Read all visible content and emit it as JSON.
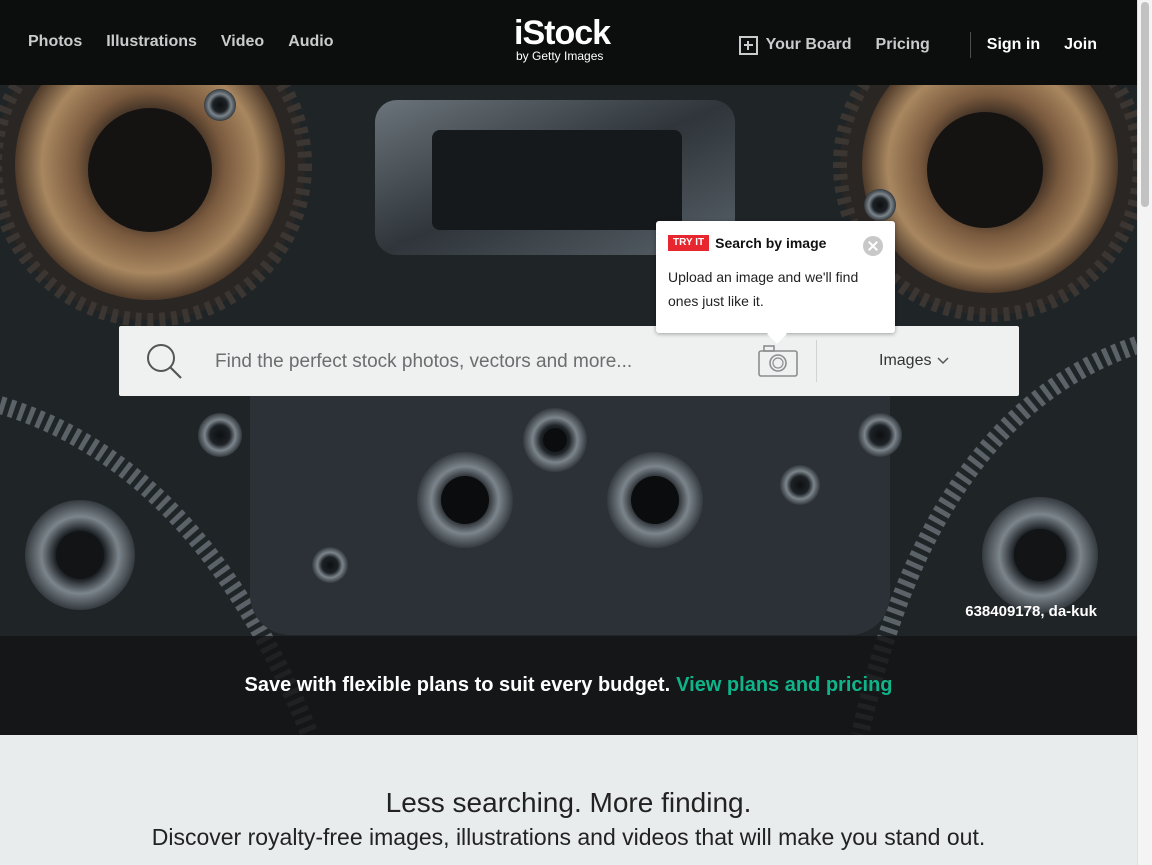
{
  "nav": {
    "left": [
      "Photos",
      "Illustrations",
      "Video",
      "Audio"
    ],
    "logo_main": "iStock",
    "logo_sub": "by Getty Images",
    "your_board": "Your Board",
    "pricing": "Pricing",
    "sign_in": "Sign in",
    "join": "Join"
  },
  "search": {
    "placeholder": "Find the perfect stock photos, vectors and more...",
    "type": "Images"
  },
  "tooltip": {
    "badge": "TRY IT",
    "title": "Search by image",
    "body": "Upload an image and we'll find ones just like it."
  },
  "hero": {
    "credit": "638409178, da-kuk"
  },
  "promo": {
    "text": "Save with flexible plans to suit every budget.",
    "link": "View plans and pricing"
  },
  "lower": {
    "title": "Less searching. More finding.",
    "subtitle": "Discover royalty-free images, illustrations and videos that will make you stand out."
  },
  "colors": {
    "header_bg": "#0c0d0d",
    "accent_green": "#10b48a",
    "badge_red": "#e8262f"
  }
}
